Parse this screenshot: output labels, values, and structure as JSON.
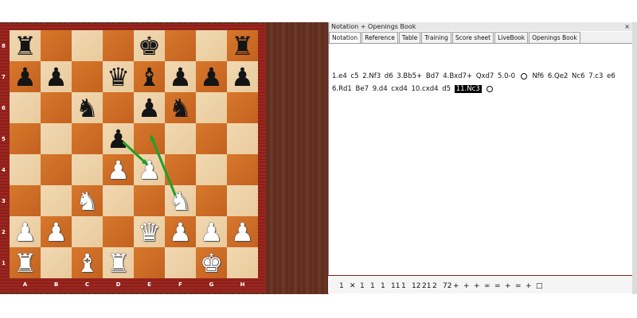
{
  "panel": {
    "title": "Notation + Openings Book",
    "close": "×",
    "tabs": [
      "Notation",
      "Reference",
      "Table",
      "Training",
      "Score sheet",
      "LiveBook",
      "Openings Book"
    ],
    "active_tab": "Notation"
  },
  "notation": {
    "moves_before": "1.e4  c5  2.Nf3  d6  3.Bb5+  Bd7  4.Bxd7+  Qxd7  5.0-0",
    "moves_middle": "Nf6  6.Qe2  Nc6  7.c3  e6  6.Rd1  Be7  9.d4  cxd4  10.cxd4  d5",
    "current_move": "11.Nc3"
  },
  "bottombar": {
    "items": [
      "1",
      "✕",
      "1",
      "1",
      "1",
      "11",
      "1",
      "12",
      "21",
      "2",
      "72",
      "+",
      "+",
      "+",
      "∞",
      "=",
      "+",
      "=",
      "+",
      "□"
    ]
  },
  "board": {
    "ranks": [
      "8",
      "7",
      "6",
      "5",
      "4",
      "3",
      "2",
      "1"
    ],
    "files": [
      "A",
      "B",
      "C",
      "D",
      "E",
      "F",
      "G",
      "H"
    ],
    "position": [
      [
        "br",
        "",
        "",
        "",
        "bk",
        "",
        "",
        "br"
      ],
      [
        "bp",
        "bp",
        "",
        "bq",
        "bb",
        "bp",
        "bp",
        "bp"
      ],
      [
        "",
        "",
        "bn",
        "",
        "bp",
        "bn",
        "",
        ""
      ],
      [
        "",
        "",
        "",
        "bp",
        "",
        "",
        "",
        ""
      ],
      [
        "",
        "",
        "",
        "wp",
        "wp",
        "",
        "",
        ""
      ],
      [
        "",
        "",
        "wn",
        "",
        "",
        "wn",
        "",
        ""
      ],
      [
        "wp",
        "wp",
        "",
        "",
        "wq",
        "wp",
        "wp",
        "wp"
      ],
      [
        "wr",
        "",
        "wb",
        "wr",
        "",
        "",
        "wk",
        ""
      ]
    ],
    "arrow_color": "#1fa02a"
  }
}
